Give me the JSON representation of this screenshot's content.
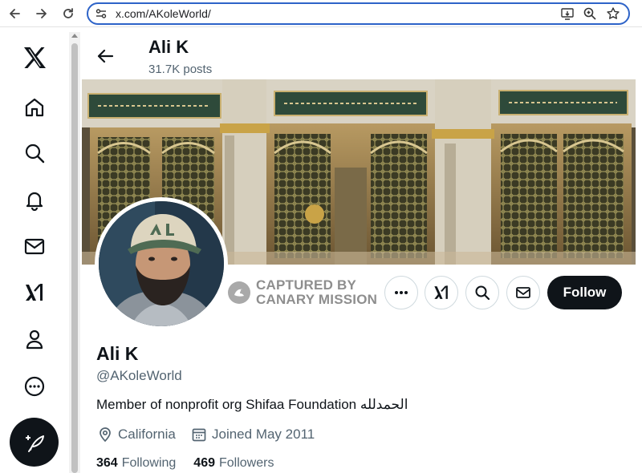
{
  "browser": {
    "url": "x.com/AKoleWorld/"
  },
  "header": {
    "name": "Ali K",
    "posts": "31.7K posts"
  },
  "profile": {
    "captured_line1": "CAPTURED BY",
    "captured_line2": "CANARY MISSION",
    "follow_label": "Follow",
    "name": "Ali K",
    "handle": "@AKoleWorld",
    "bio": "Member of nonprofit org Shifaa Foundation الحمدلله",
    "location": "California",
    "joined": "Joined May 2011",
    "following_count": "364",
    "following_label": "Following",
    "followers_count": "469",
    "followers_label": "Followers"
  },
  "icons": {
    "nav": [
      "x-logo-icon",
      "home-icon",
      "search-icon",
      "bell-icon",
      "mail-icon",
      "grok-icon",
      "profile-icon",
      "more-icon"
    ],
    "compose": "compose-post-icon"
  },
  "colors": {
    "follow_bg": "#0f1419",
    "address_border": "#2d63c8",
    "secondary_text": "#536471"
  }
}
